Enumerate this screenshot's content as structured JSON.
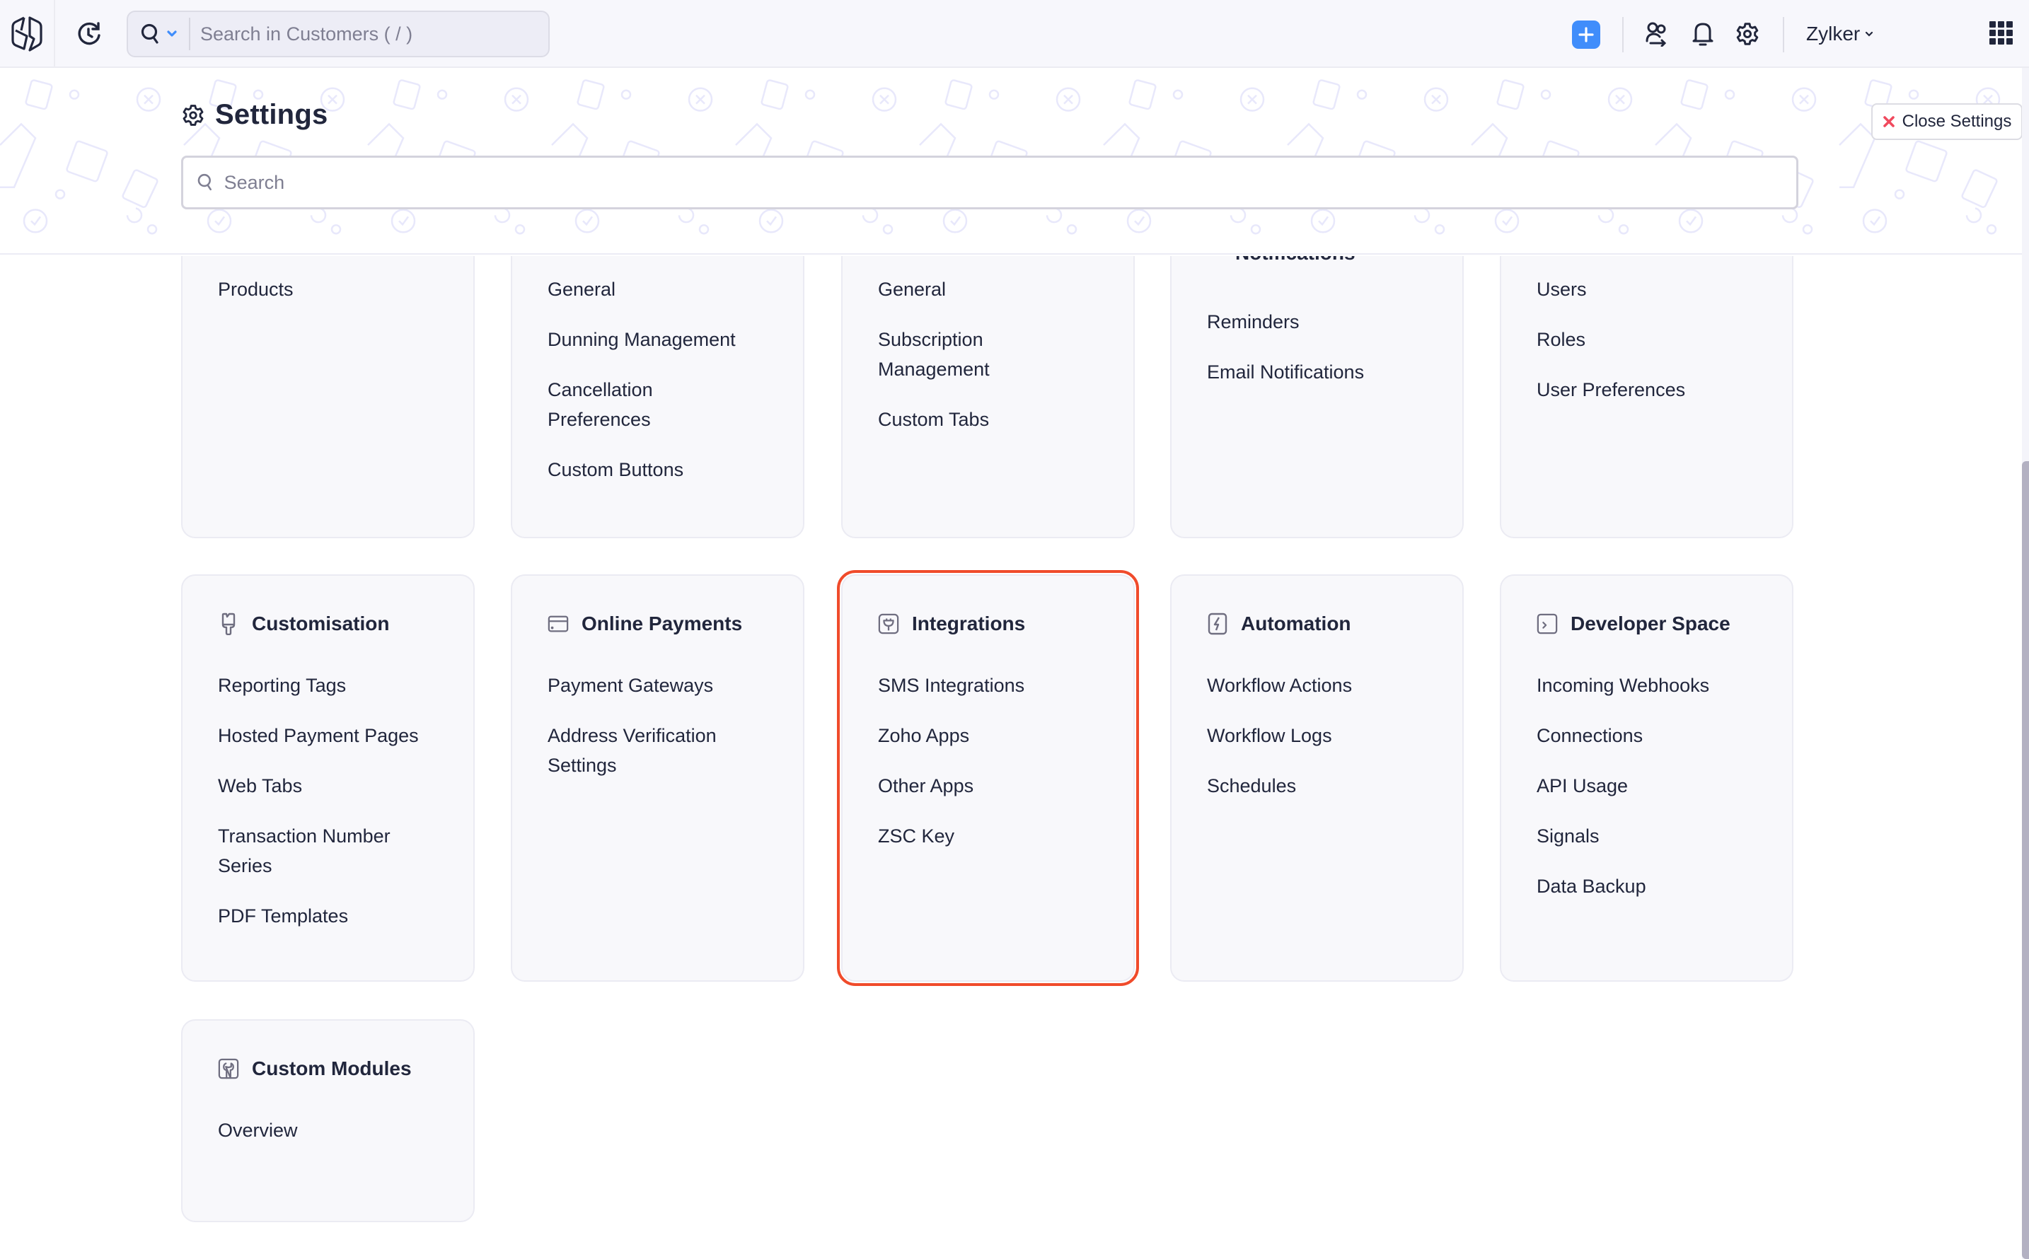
{
  "topbar": {
    "logo_icon": "app-logo-icon",
    "recent_icon": "recent-history-icon",
    "search": {
      "scope_icon": "search-icon",
      "scope_caret_icon": "chevron-down-icon",
      "placeholder": "Search in Customers ( / )",
      "value": ""
    },
    "add_icon": "plus-icon",
    "actions": [
      "team-icon",
      "bell-icon",
      "gear-icon"
    ],
    "org_name": "Zylker",
    "org_caret_icon": "chevron-down-icon",
    "apps_icon": "app-grid-icon",
    "accent_color": "#408dfb"
  },
  "settings": {
    "title": "Settings",
    "title_icon": "gear-icon",
    "close_label": "Close Settings",
    "close_icon": "close-icon",
    "close_icon_color": "#f04a5e",
    "search": {
      "placeholder": "Search",
      "value": ""
    }
  },
  "sections_row1": [
    {
      "heading": "",
      "items": [
        "Products"
      ]
    },
    {
      "heading": "",
      "items": [
        "General",
        "Dunning Management",
        "Cancellation Preferences",
        "Custom Buttons"
      ]
    },
    {
      "heading": "",
      "items": [
        "General",
        "Subscription Management",
        "Custom Tabs"
      ]
    },
    {
      "heading": "Notifications",
      "items": [
        "Reminders",
        "Email Notifications"
      ]
    },
    {
      "heading": "",
      "items": [
        "Users",
        "Roles",
        "User Preferences"
      ]
    }
  ],
  "sections_row2": [
    {
      "heading": "Customisation",
      "icon": "paint-brush-icon",
      "items": [
        "Reporting Tags",
        "Hosted Payment Pages",
        "Web Tabs",
        "Transaction Number Series",
        "PDF Templates"
      ]
    },
    {
      "heading": "Online Payments",
      "icon": "card-icon",
      "items": [
        "Payment Gateways",
        "Address Verification Settings"
      ]
    },
    {
      "heading": "Integrations",
      "icon": "plug-icon",
      "items": [
        "SMS Integrations",
        "Zoho Apps",
        "Other Apps",
        "ZSC Key"
      ],
      "highlighted": true
    },
    {
      "heading": "Automation",
      "icon": "lightning-icon",
      "items": [
        "Workflow Actions",
        "Workflow Logs",
        "Schedules"
      ]
    },
    {
      "heading": "Developer Space",
      "icon": "terminal-icon",
      "items": [
        "Incoming Webhooks",
        "Connections",
        "API Usage",
        "Signals",
        "Data Backup"
      ]
    }
  ],
  "sections_row3": [
    {
      "heading": "Custom Modules",
      "icon": "wrench-icon",
      "items": [
        "Overview"
      ]
    }
  ],
  "highlight_color": "#f04b2b",
  "scroll": {
    "position_fraction": 0.33
  }
}
